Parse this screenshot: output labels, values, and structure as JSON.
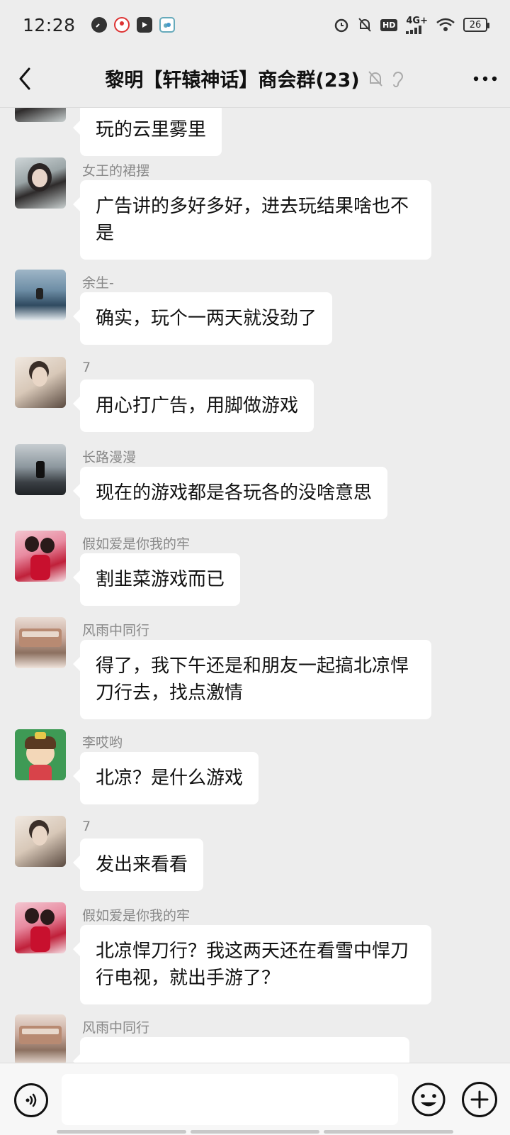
{
  "status_bar": {
    "time": "12:28",
    "network": "4G+",
    "hd": "HD",
    "battery": "26",
    "icons": [
      "speed-icon",
      "location-pin-icon",
      "video-play-icon",
      "cloud-app-icon",
      "alarm-icon",
      "mute-bell-icon",
      "hd-icon",
      "signal-icon",
      "wifi-icon",
      "battery-icon"
    ]
  },
  "header": {
    "title": "黎明【轩辕神话】商会群(23)",
    "back_icon": "back-arrow-icon",
    "mute_icon": "mute-bell-icon",
    "ear_icon": "earpiece-icon",
    "more_icon": "more-dots-icon"
  },
  "messages": [
    {
      "sender": "",
      "text": "玩的云里雾里",
      "avatar": "woman-lying-avatar"
    },
    {
      "sender": "女王的裙摆",
      "text": "广告讲的多好多好，进去玩结果啥也不是",
      "avatar": "woman-portrait-avatar"
    },
    {
      "sender": "余生-",
      "text": "确实，玩个一两天就没劲了",
      "avatar": "boat-avatar"
    },
    {
      "sender": "7",
      "text": "用心打广告，用脚做游戏",
      "avatar": "man-glasses-avatar"
    },
    {
      "sender": "长路漫漫",
      "text": "现在的游戏都是各玩各的没啥意思",
      "avatar": "mountain-avatar"
    },
    {
      "sender": "假如爱是你我的牢",
      "text": "割韭菜游戏而已",
      "avatar": "couple-avatar"
    },
    {
      "sender": "风雨中同行",
      "text": "得了，我下午还是和朋友一起搞北凉悍刀行去，找点激情",
      "avatar": "train-avatar"
    },
    {
      "sender": "李哎哟",
      "text": "北凉？是什么游戏",
      "avatar": "cartoon-girl-avatar"
    },
    {
      "sender": "7",
      "text": "发出来看看",
      "avatar": "man-glasses-avatar"
    },
    {
      "sender": "假如爱是你我的牢",
      "text": "北凉悍刀行？我这两天还在看雪中悍刀行电视，就出手游了？",
      "avatar": "couple-avatar"
    },
    {
      "sender": "风雨中同行",
      "text": "",
      "avatar": "train-avatar"
    }
  ],
  "input_bar": {
    "voice_icon": "voice-icon",
    "emoji_icon": "emoji-icon",
    "plus_icon": "plus-icon",
    "input_value": ""
  }
}
